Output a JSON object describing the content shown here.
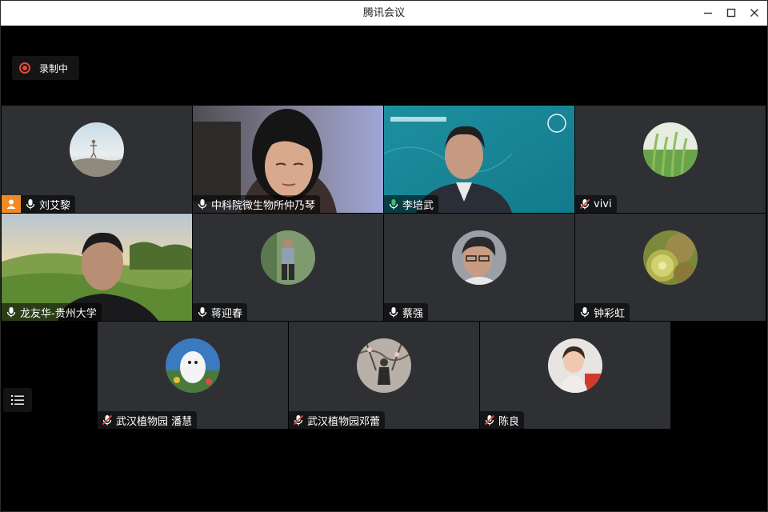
{
  "window": {
    "title": "腾讯会议"
  },
  "recording": {
    "label": "录制中"
  },
  "colors": {
    "tile_bg": "#2e3034",
    "speaking": "#35c46a",
    "muted": "#e24a3a",
    "host": "#f08a24"
  },
  "participants": [
    {
      "name": "刘艾黎",
      "mic": "on",
      "host": true,
      "view": "avatar"
    },
    {
      "name": "中科院微生物所仲乃琴",
      "mic": "on",
      "view": "video"
    },
    {
      "name": "李培武",
      "mic": "speaking",
      "view": "video"
    },
    {
      "name": "vivi",
      "mic": "muted",
      "view": "avatar"
    },
    {
      "name": "龙友华-贵州大学",
      "mic": "on",
      "view": "video"
    },
    {
      "name": "蒋迎春",
      "mic": "on",
      "view": "avatar"
    },
    {
      "name": "蔡强",
      "mic": "on",
      "view": "avatar"
    },
    {
      "name": "钟彩虹",
      "mic": "on",
      "view": "avatar"
    },
    {
      "name": "武汉植物园 潘慧",
      "mic": "muted",
      "view": "avatar"
    },
    {
      "name": "武汉植物园邓蕾",
      "mic": "muted",
      "view": "avatar"
    },
    {
      "name": "陈良",
      "mic": "muted",
      "view": "avatar"
    }
  ]
}
